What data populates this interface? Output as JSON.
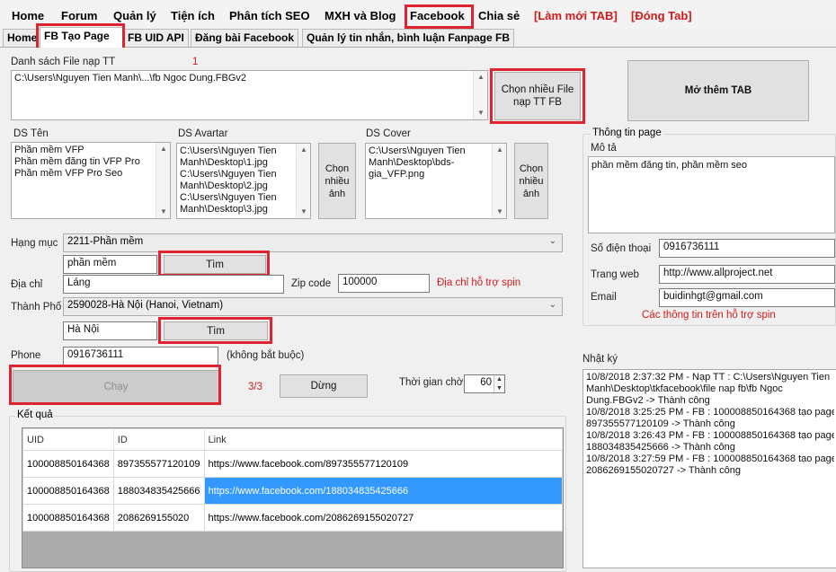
{
  "menu": {
    "items": [
      "Home",
      "Forum",
      "Quản lý",
      "Tiện ích",
      "Phân tích SEO",
      "MXH và Blog",
      "Facebook",
      "Chia sẻ",
      "[Làm mới TAB]",
      "[Đóng Tab]"
    ]
  },
  "tabs": [
    "Home",
    "FB Tạo Page",
    "FB UID API",
    "Đăng bài Facebook",
    "Quản lý tin nhắn, bình luận Fanpage FB"
  ],
  "files": {
    "label": "Danh sách File nạp TT",
    "count": "1",
    "path": "C:\\Users\\Nguyen Tien Manh\\...\\fb Ngoc Dung.FBGv2",
    "choose_btn": "Chọn nhiều File nạp TT FB",
    "more_tab_btn": "Mở thêm TAB"
  },
  "ds_ten": {
    "label": "DS Tên",
    "lines": [
      "Phần mềm VFP",
      "Phần mềm đăng tin VFP Pro",
      "Phần mềm VFP Pro Seo"
    ]
  },
  "ds_avatar": {
    "label": "DS Avartar",
    "lines": [
      "C:\\Users\\Nguyen Tien",
      "Manh\\Desktop\\1.jpg",
      "C:\\Users\\Nguyen Tien",
      "Manh\\Desktop\\2.jpg",
      "C:\\Users\\Nguyen Tien",
      "Manh\\Desktop\\3.jpg"
    ],
    "btn": "Chọn nhiều ảnh"
  },
  "ds_cover": {
    "label": "DS Cover",
    "lines": [
      "C:\\Users\\Nguyen Tien",
      "Manh\\Desktop\\bds-",
      "gia_VFP.png"
    ],
    "btn": "Chọn nhiều ảnh"
  },
  "form": {
    "hang_muc_label": "Hạng mục",
    "hang_muc_value": "2211-Phần mềm",
    "hang_muc_search": "phần mềm",
    "tim_label": "Tìm",
    "dia_chi_label": "Địa chỉ",
    "dia_chi_value": "Láng",
    "zip_label": "Zip code",
    "zip_value": "100000",
    "spin_note": "Địa chỉ hỗ trợ spin",
    "thanh_pho_label": "Thành Phố",
    "thanh_pho_value": "2590028-Hà Nội (Hanoi, Vietnam)",
    "thanh_pho_search": "Hà Nội",
    "phone_label": "Phone",
    "phone_value": "0916736111",
    "phone_note": "(không bắt buộc)"
  },
  "run": {
    "chay": "Chạy",
    "progress": "3/3",
    "dung": "Dừng",
    "wait_label": "Thời gian chờ",
    "wait_value": "60"
  },
  "page_info": {
    "title": "Thông tin page",
    "mota_label": "Mô tả",
    "mota_value": "phần mềm đăng tin, phần mềm seo",
    "sdt_label": "Số điện thoại",
    "sdt_value": "0916736111",
    "web_label": "Trang web",
    "web_value": "http://www.allproject.net",
    "email_label": "Email",
    "email_value": "buidinhgt@gmail.com",
    "spin_note": "Các thông tin trên hỗ trợ spin"
  },
  "log": {
    "title": "Nhật ký",
    "lines": [
      "10/8/2018 2:37:32 PM - Nạp TT : C:\\Users\\Nguyen Tien",
      "Manh\\Desktop\\tkfacebook\\file nap fb\\fb Ngoc",
      "Dung.FBGv2 -> Thành công",
      "10/8/2018 3:25:25 PM - FB : 100008850164368 tạo page",
      "897355577120109 -> Thành công",
      "10/8/2018 3:26:43 PM - FB : 100008850164368 tạo page",
      "188034835425666 -> Thành công",
      "10/8/2018 3:27:59 PM - FB : 100008850164368 tạo page",
      "2086269155020727 -> Thành công"
    ]
  },
  "results": {
    "title": "Kết quả",
    "headers": [
      "UID",
      "ID",
      "Link"
    ],
    "rows": [
      [
        "100008850164368",
        "897355577120109",
        "https://www.facebook.com/897355577120109"
      ],
      [
        "100008850164368",
        "188034835425666",
        "https://www.facebook.com/188034835425666"
      ],
      [
        "100008850164368",
        "2086269155020",
        "https://www.facebook.com/2086269155020727"
      ]
    ]
  }
}
